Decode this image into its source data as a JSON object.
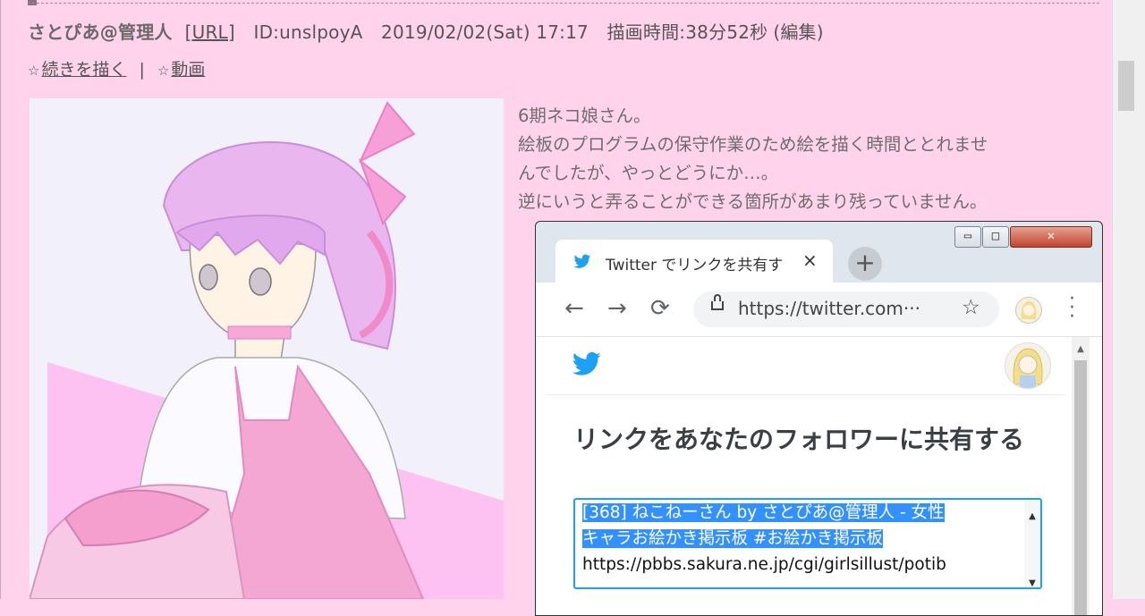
{
  "post": {
    "author": "さとぴあ@管理人",
    "url_label": "[URL]",
    "id": "ID:unslpoyA",
    "datetime": "2019/02/02(Sat) 17:17",
    "draw_time": "描画時間:38分52秒",
    "edit": "(編集)",
    "star": "☆",
    "continue_label": "続きを描く",
    "separator": "|",
    "video_label": "動画",
    "comment_lines": [
      "6期ネコ娘さん。",
      "絵板のプログラムの保守作業のため絵を描く時間ととれませ",
      "んでしたが、やっとどうにか…。",
      "逆にいうと弄ることができる箇所があまり残っていません。"
    ]
  },
  "browser": {
    "tab_title": "Twitter でリンクを共有す",
    "tab_close": "×",
    "new_tab": "+",
    "url": "https://twitter.com···",
    "window_buttons": {
      "minimize": "▭",
      "maximize": "□",
      "close": "✕"
    }
  },
  "twitter": {
    "share_title": "リンクをあなたのフォロワーに共有する",
    "text_lines": [
      "[368] ねこねーさん by さとぴあ@管理人 - 女性",
      "キャラお絵かき掲示板 #お絵かき掲示板",
      "https://pbbs.sakura.ne.jp/cgi/girlsillust/potib"
    ]
  },
  "colors": {
    "page_bg": "#ffd3ec",
    "twitter_blue": "#1da1f2",
    "selection": "#3390ff"
  },
  "icons": [
    "twitter-bird-icon",
    "back-arrow-icon",
    "forward-arrow-icon",
    "reload-icon",
    "lock-icon",
    "star-icon",
    "menu-dots-icon",
    "close-icon",
    "plus-icon"
  ]
}
